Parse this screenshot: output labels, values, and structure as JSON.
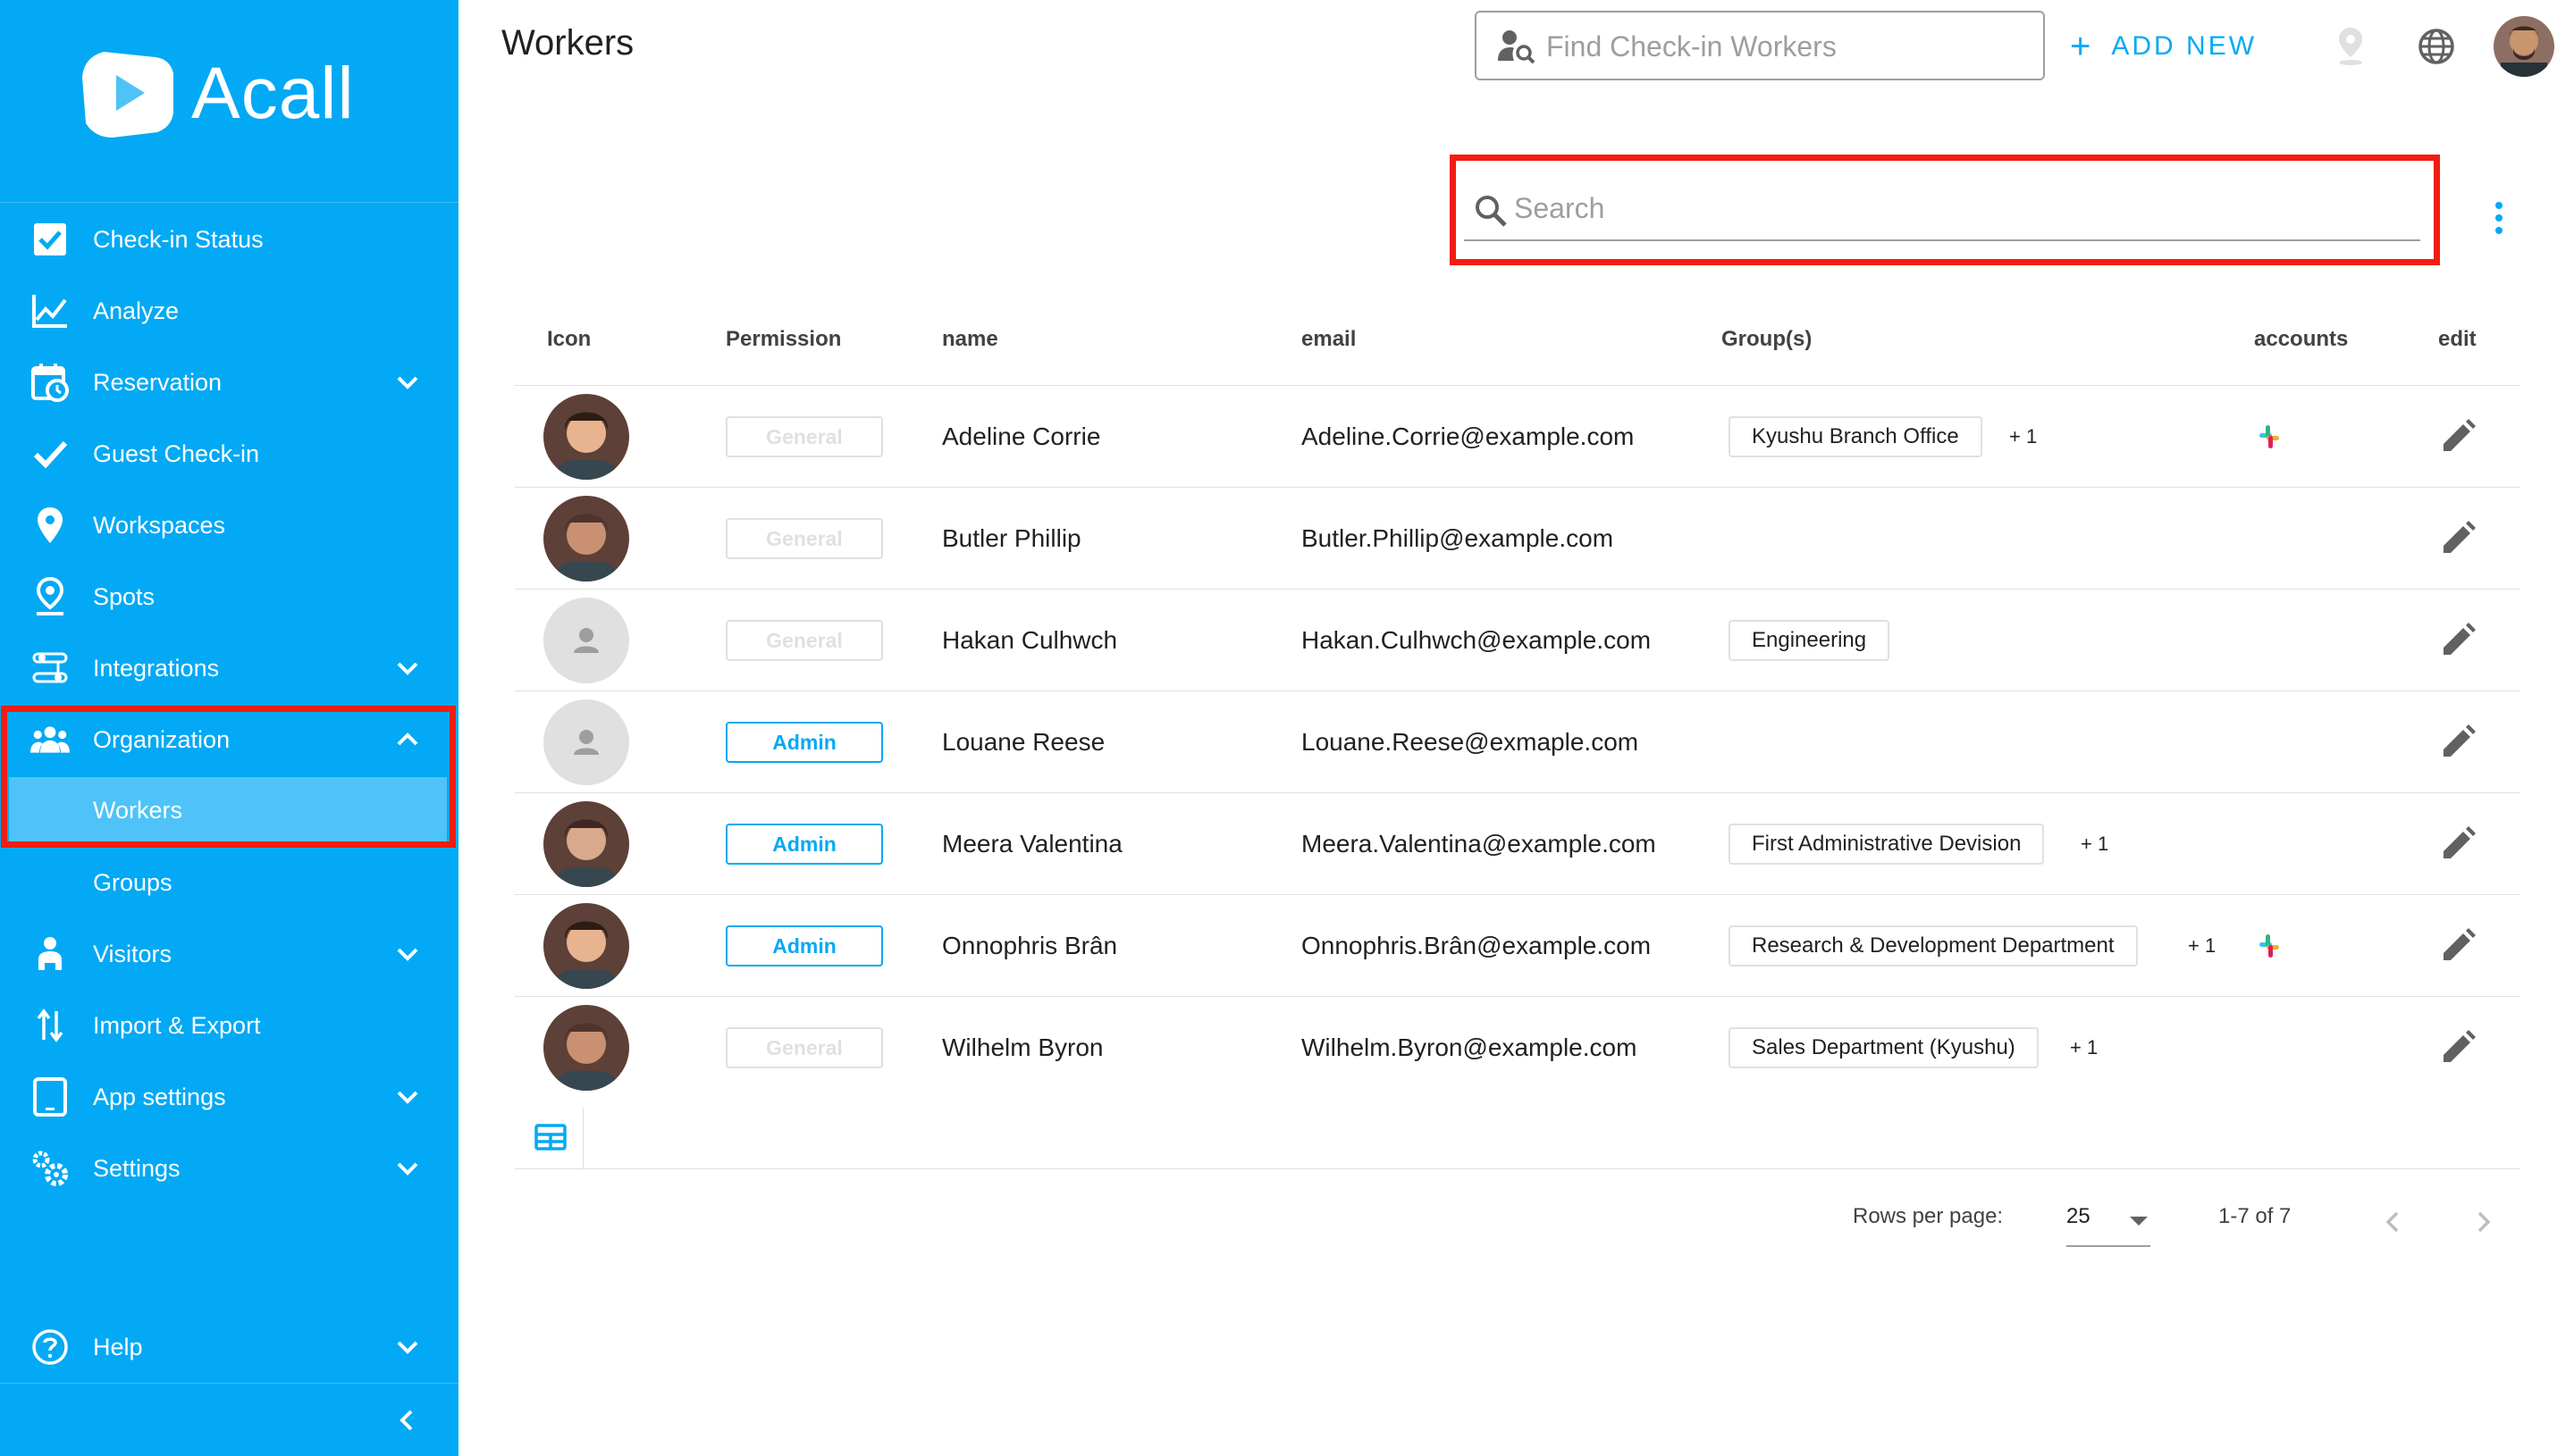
{
  "brand": {
    "name": "Acall",
    "accent": "#03a9f4",
    "sidebar_bg": "#03a9f4",
    "highlight": "#f21c10"
  },
  "sidebar": {
    "items": [
      {
        "label": "Check-in Status",
        "icon": "checkbox-icon"
      },
      {
        "label": "Analyze",
        "icon": "chart-line-icon"
      },
      {
        "label": "Reservation",
        "icon": "calendar-clock-icon",
        "expandable": true
      },
      {
        "label": "Guest Check-in",
        "icon": "check-icon"
      },
      {
        "label": "Workspaces",
        "icon": "map-pin-icon"
      },
      {
        "label": "Spots",
        "icon": "pin-drop-icon"
      },
      {
        "label": "Integrations",
        "icon": "sliders-icon",
        "expandable": true
      },
      {
        "label": "Organization",
        "icon": "people-icon",
        "expanded": true
      },
      {
        "label": "Workers",
        "sub": true,
        "active": true
      },
      {
        "label": "Groups",
        "sub": true
      },
      {
        "label": "Visitors",
        "icon": "visitor-icon",
        "expandable": true
      },
      {
        "label": "Import & Export",
        "icon": "swap-vertical-icon"
      },
      {
        "label": "App settings",
        "icon": "tablet-icon",
        "expandable": true
      },
      {
        "label": "Settings",
        "icon": "gears-icon",
        "expandable": true
      }
    ],
    "help": "Help"
  },
  "header": {
    "title": "Workers",
    "find_placeholder": "Find Check-in Workers",
    "add_new": "ADD NEW"
  },
  "search": {
    "placeholder": "Search"
  },
  "table": {
    "columns": [
      "Icon",
      "Permission",
      "name",
      "email",
      "Group(s)",
      "accounts",
      "edit"
    ],
    "rows": [
      {
        "permission": "General",
        "name": "Adeline Corrie",
        "email": "Adeline.Corrie@example.com",
        "group": "Kyushu Branch Office",
        "more": "+ 1",
        "slack": true,
        "avatar": "photo"
      },
      {
        "permission": "General",
        "name": "Butler Phillip",
        "email": "Butler.Phillip@example.com",
        "group": "",
        "more": "",
        "slack": false,
        "avatar": "photo"
      },
      {
        "permission": "General",
        "name": "Hakan Culhwch",
        "email": "Hakan.Culhwch@example.com",
        "group": "Engineering",
        "more": "",
        "slack": false,
        "avatar": "placeholder"
      },
      {
        "permission": "Admin",
        "name": "Louane Reese",
        "email": "Louane.Reese@exmaple.com",
        "group": "",
        "more": "",
        "slack": false,
        "avatar": "placeholder"
      },
      {
        "permission": "Admin",
        "name": "Meera Valentina",
        "email": "Meera.Valentina@example.com",
        "group": "First Administrative Devision",
        "more": "+ 1",
        "slack": false,
        "avatar": "photo"
      },
      {
        "permission": "Admin",
        "name": "Onnophris Brân",
        "email": "Onnophris.Brân@example.com",
        "group": "Research & Development Department",
        "more": "+ 1",
        "slack": true,
        "avatar": "photo"
      },
      {
        "permission": "General",
        "name": "Wilhelm Byron",
        "email": "Wilhelm.Byron@example.com",
        "group": "Sales Department (Kyushu)",
        "more": "+ 1",
        "slack": false,
        "avatar": "photo"
      }
    ]
  },
  "pagination": {
    "rows_per_page_label": "Rows per page:",
    "rows_per_page": "25",
    "range": "1-7 of 7"
  }
}
